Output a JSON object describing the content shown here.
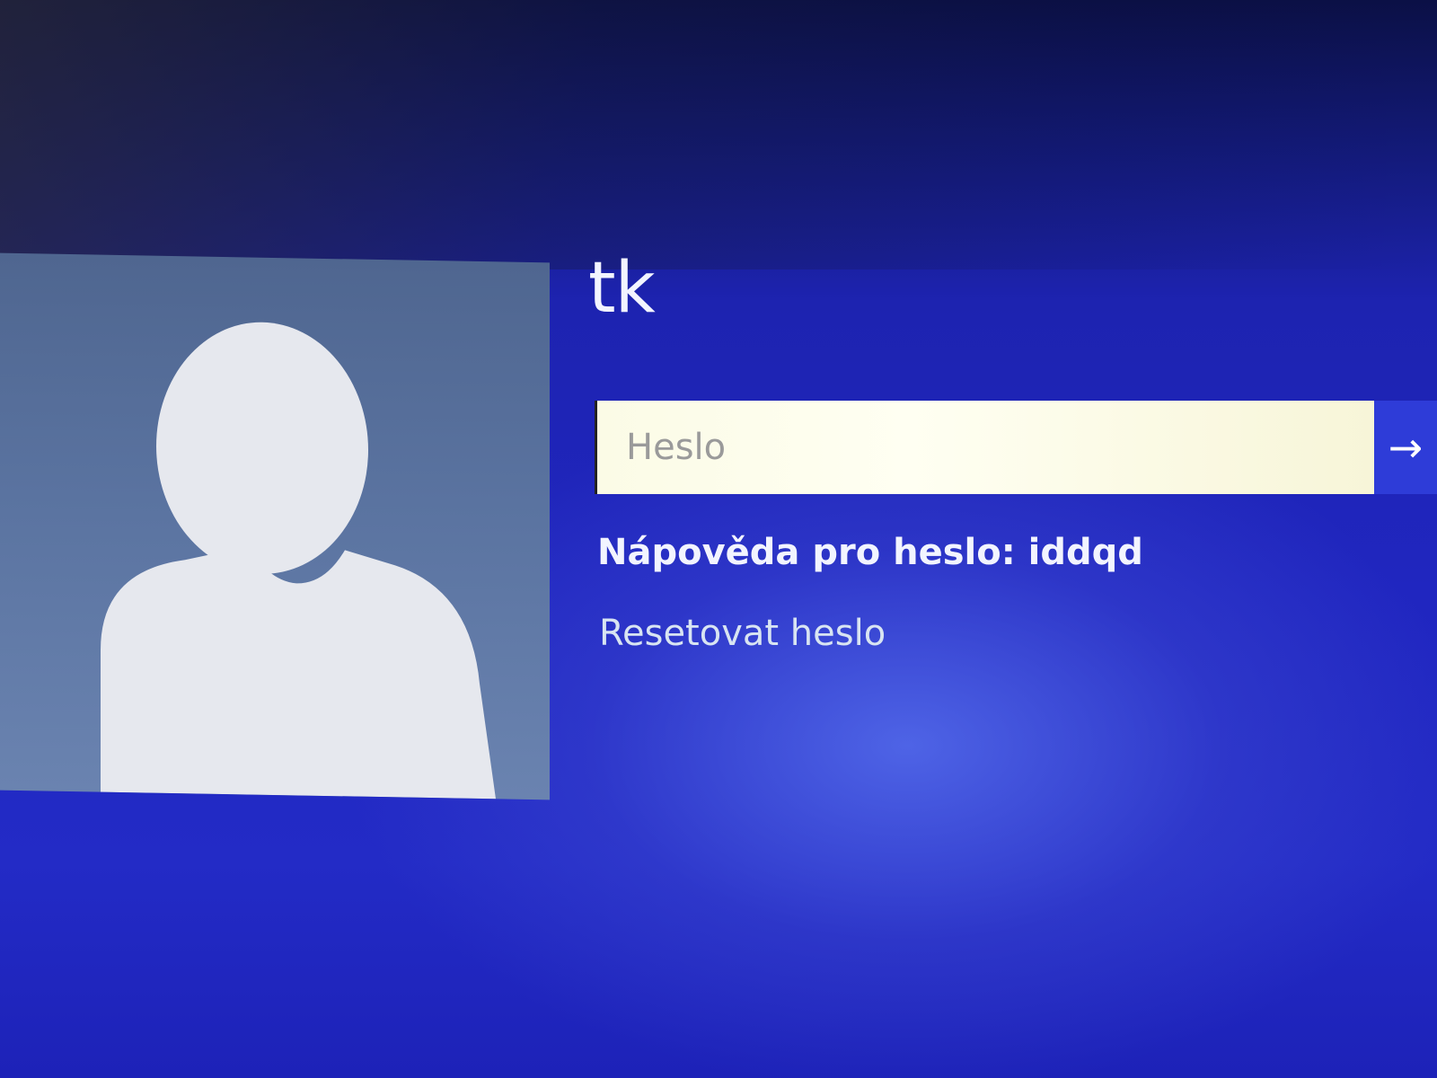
{
  "colors": {
    "background": "#2026c0",
    "avatar_background": "#5a73a0",
    "avatar_silhouette": "#e6e8ee",
    "input_background": "#fffff2",
    "submit_button": "#2e3cd8",
    "text": "#f2f4ff"
  },
  "user": {
    "avatar_icon": "user-silhouette-icon",
    "name": "tk"
  },
  "login": {
    "password_placeholder": "Heslo",
    "password_value": "",
    "submit_icon": "arrow-right-icon",
    "submit_glyph": "→",
    "hint_text": "Nápověda pro heslo: iddqd",
    "reset_link": "Resetovat heslo"
  }
}
